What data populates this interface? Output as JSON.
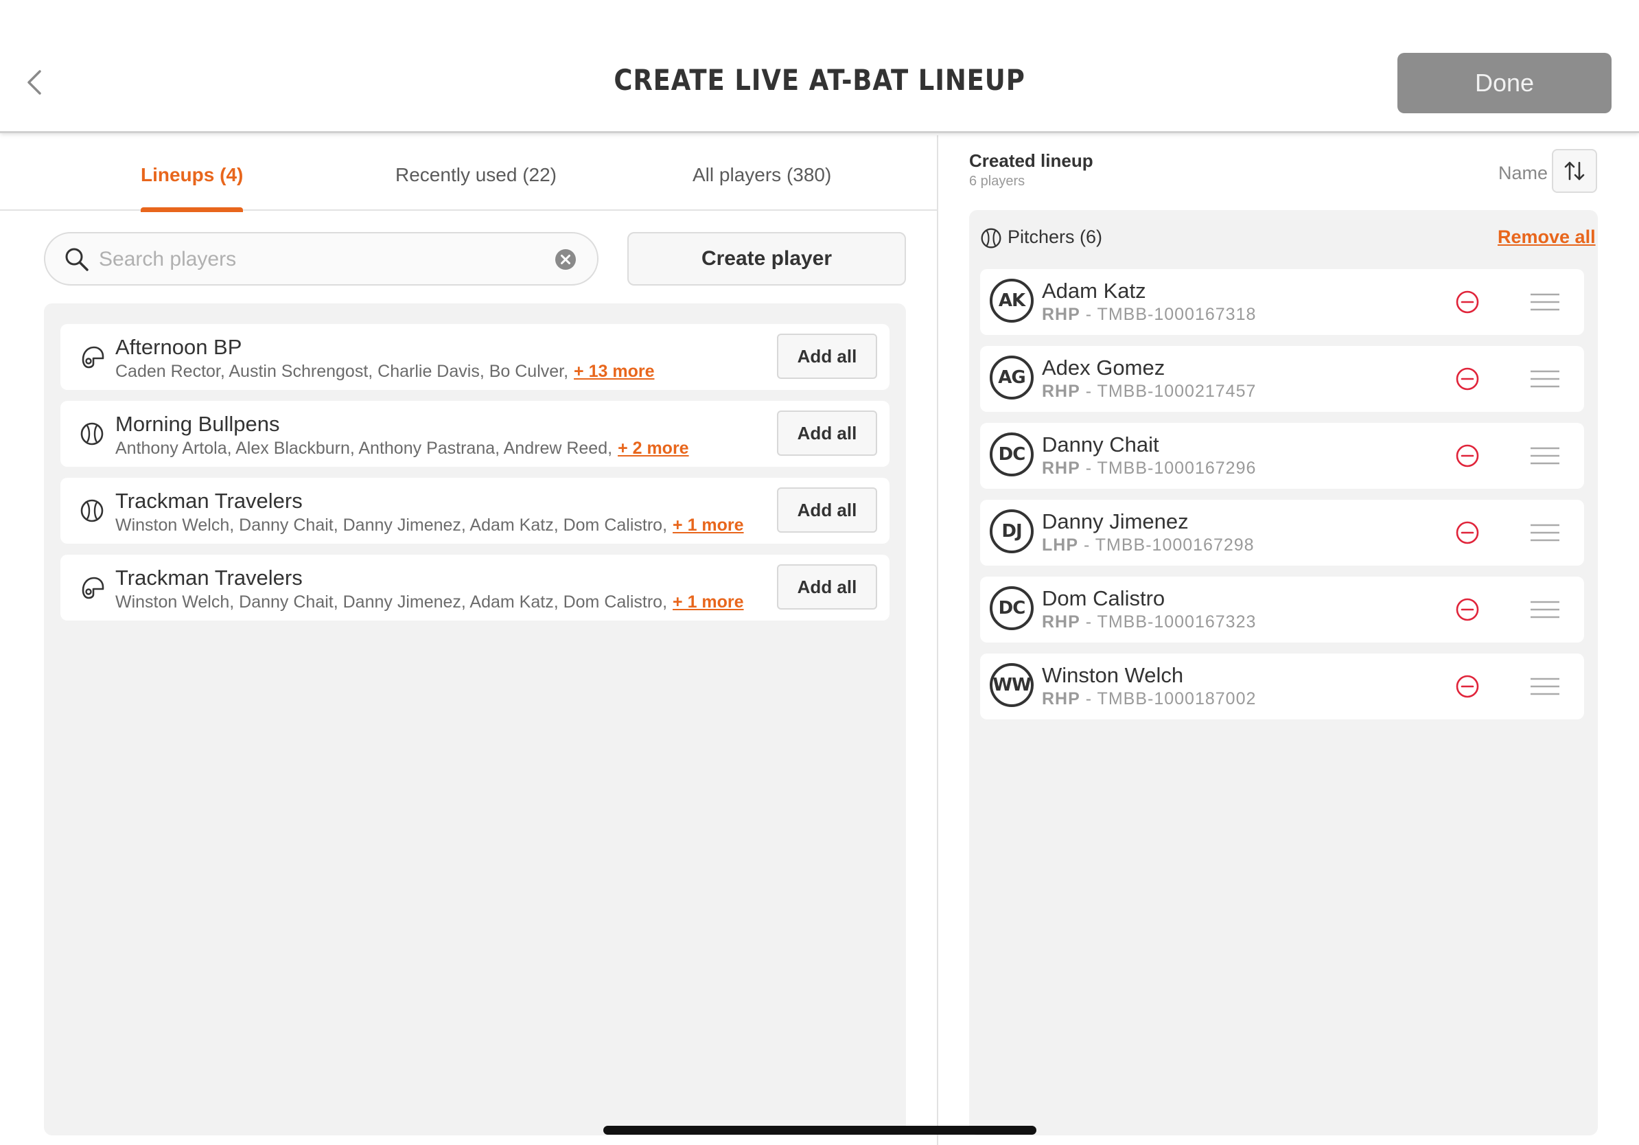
{
  "header": {
    "title": "CREATE LIVE AT-BAT LINEUP",
    "back_icon": "chevron-left-icon",
    "done_label": "Done"
  },
  "tabs": [
    {
      "label": "Lineups (4)",
      "active": true
    },
    {
      "label": "Recently used (22)",
      "active": false
    },
    {
      "label": "All players (380)",
      "active": false
    }
  ],
  "search": {
    "placeholder": "Search players",
    "value": ""
  },
  "create_player_label": "Create player",
  "lineups": [
    {
      "icon": "batting-helmet-icon",
      "name": "Afternoon BP",
      "players": "Caden Rector, Austin Schrengost, Charlie Davis, Bo Culver,",
      "more": "+ 13 more",
      "button": "Add all"
    },
    {
      "icon": "baseball-icon",
      "name": "Morning Bullpens",
      "players": "Anthony Artola, Alex Blackburn, Anthony Pastrana, Andrew Reed,",
      "more": "+ 2 more",
      "button": "Add all"
    },
    {
      "icon": "baseball-icon",
      "name": "Trackman Travelers",
      "players": "Winston Welch, Danny Chait, Danny Jimenez, Adam Katz, Dom Calistro,",
      "more": "+ 1 more",
      "button": "Add all"
    },
    {
      "icon": "batting-helmet-icon",
      "name": "Trackman Travelers",
      "players": "Winston Welch, Danny Chait, Danny Jimenez, Adam Katz, Dom Calistro,",
      "more": "+ 1 more",
      "button": "Add all"
    }
  ],
  "created": {
    "title": "Created lineup",
    "subtitle": "6 players",
    "sort_label": "Name",
    "sort_icon": "sort-arrows-icon",
    "group_label": "Pitchers (6)",
    "group_icon": "baseball-icon",
    "remove_all_label": "Remove all",
    "players": [
      {
        "initials": "AK",
        "name": "Adam Katz",
        "hand": "RHP",
        "id": " - TMBB-1000167318"
      },
      {
        "initials": "AG",
        "name": "Adex Gomez",
        "hand": "RHP",
        "id": " - TMBB-1000217457"
      },
      {
        "initials": "DC",
        "name": "Danny Chait",
        "hand": "RHP",
        "id": " - TMBB-1000167296"
      },
      {
        "initials": "DJ",
        "name": "Danny Jimenez",
        "hand": "LHP",
        "id": " - TMBB-1000167298"
      },
      {
        "initials": "DC",
        "name": "Dom Calistro",
        "hand": "RHP",
        "id": " - TMBB-1000167323"
      },
      {
        "initials": "WW",
        "name": "Winston Welch",
        "hand": "RHP",
        "id": " - TMBB-1000187002"
      }
    ]
  },
  "colors": {
    "accent": "#e8661c",
    "remove": "#e0243a",
    "done_bg": "#8d8d8d"
  }
}
